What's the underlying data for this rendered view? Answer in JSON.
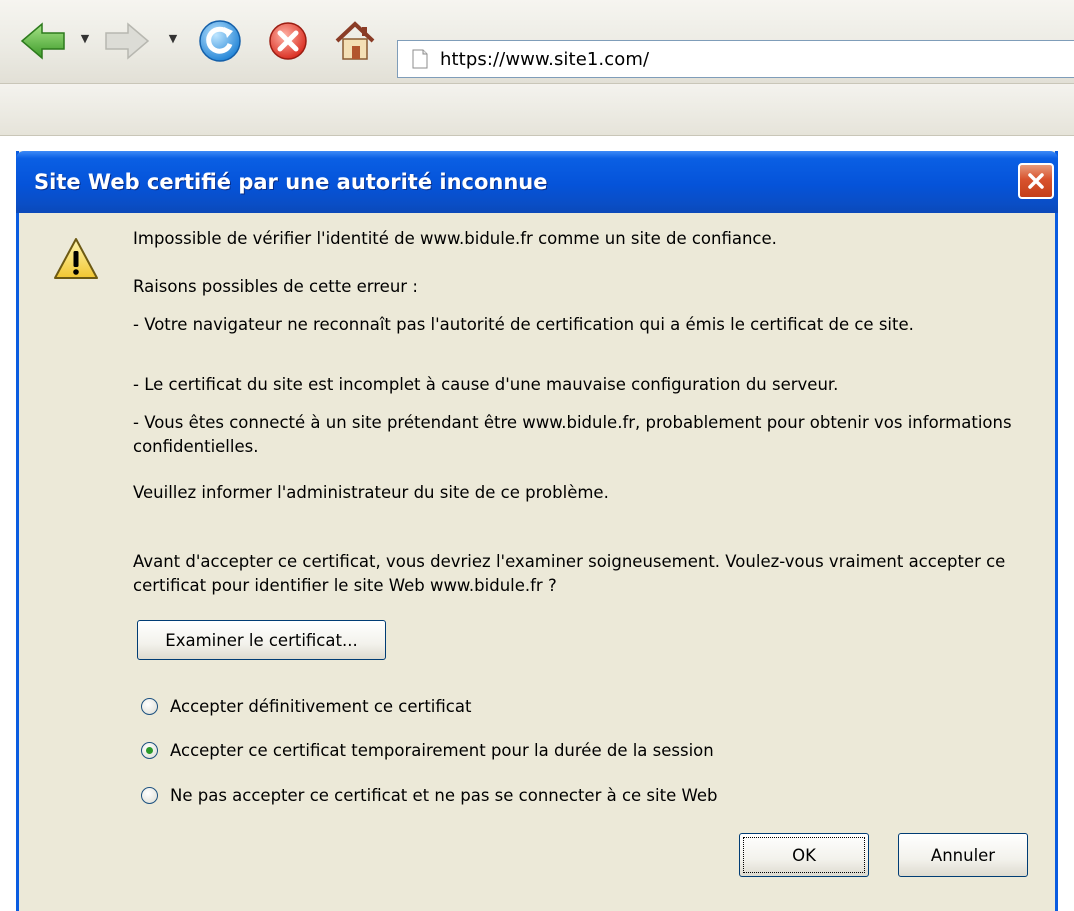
{
  "browser": {
    "url": "https://www.site1.com/",
    "icons": [
      "back-arrow-icon",
      "forward-arrow-icon",
      "reload-icon",
      "stop-icon",
      "home-icon",
      "page-icon"
    ]
  },
  "dialog": {
    "title": "Site Web certifié par une autorité inconnue",
    "message": {
      "line1": "Impossible de vérifier l'identité de www.bidule.fr comme un site de confiance.",
      "reasons_title": "Raisons possibles de cette erreur :",
      "reason1": "- Votre navigateur ne reconnaît pas l'autorité de certification qui a émis le certificat de ce site.",
      "reason2": "- Le certificat du site est incomplet à cause d'une mauvaise configuration du serveur.",
      "reason3": "- Vous êtes connecté à un site prétendant être www.bidule.fr, probablement pour obtenir vos informations confidentielles.",
      "inform": "Veuillez informer l'administrateur du site de ce problème.",
      "question": "Avant d'accepter ce certificat, vous devriez l'examiner soigneusement. Voulez-vous vraiment accepter ce certificat pour identifier le site Web www.bidule.fr ?"
    },
    "examine_button": "Examiner le certificat...",
    "options": [
      {
        "label": "Accepter définitivement ce certificat",
        "selected": false
      },
      {
        "label": "Accepter ce certificat temporairement pour la durée de la session",
        "selected": true
      },
      {
        "label": "Ne pas accepter ce certificat et ne pas se connecter à ce site Web",
        "selected": false
      }
    ],
    "ok_button": "OK",
    "cancel_button": "Annuler"
  },
  "colors": {
    "titlebar": "#0553d9",
    "dialog_bg": "#ece9d8",
    "close_button": "#d8522d"
  }
}
